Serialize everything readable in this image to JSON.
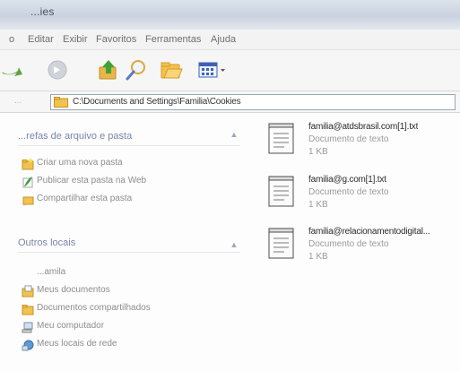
{
  "window": {
    "title": "...ies"
  },
  "menu": [
    "o",
    "Editar",
    "Exibir",
    "Favoritos",
    "Ferramentas",
    "Ajuda"
  ],
  "address": {
    "label": "...",
    "path": "C:\\Documents and Settings\\Familia\\Cookies"
  },
  "sidebar": {
    "tasks_header": "...refas de arquivo e pasta",
    "tasks": [
      {
        "label": "Criar uma nova pasta",
        "icon": "new-folder-icon"
      },
      {
        "label": "Publicar esta pasta na Web",
        "icon": "publish-web-icon"
      },
      {
        "label": "Compartilhar esta pasta",
        "icon": "share-folder-icon"
      }
    ],
    "places_header": "Outros locais",
    "places": [
      {
        "label": "...amila",
        "icon": "user-folder-icon"
      },
      {
        "label": "Meus documentos",
        "icon": "documents-folder-icon"
      },
      {
        "label": "Documentos compartilhados",
        "icon": "shared-documents-icon"
      },
      {
        "label": "Meu computador",
        "icon": "my-computer-icon"
      },
      {
        "label": "Meus locais de rede",
        "icon": "network-places-icon"
      }
    ]
  },
  "files": [
    {
      "name": "familia@atdsbrasil.com[1].txt",
      "type": "Documento de texto",
      "size": "1 KB"
    },
    {
      "name": "familia@g.com[1].txt",
      "type": "Documento de texto",
      "size": "1 KB"
    },
    {
      "name": "familia@relacionamentodigital...",
      "type": "Documento de texto",
      "size": "1 KB"
    }
  ]
}
